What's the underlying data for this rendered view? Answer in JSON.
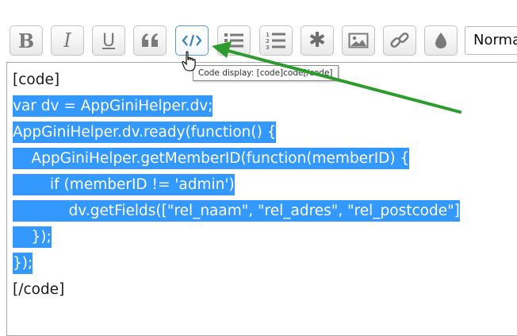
{
  "toolbar": {
    "buttons": [
      {
        "name": "bold-button",
        "icon": "bold-icon",
        "glyph": "B"
      },
      {
        "name": "italic-button",
        "icon": "italic-icon",
        "glyph": "I"
      },
      {
        "name": "underline-button",
        "icon": "underline-icon",
        "glyph": "U"
      },
      {
        "name": "quote-button",
        "icon": "quote-icon",
        "glyph": "❝"
      },
      {
        "name": "code-button",
        "icon": "code-icon",
        "glyph": "</>"
      },
      {
        "name": "bullet-list-button",
        "icon": "bullet-list-icon"
      },
      {
        "name": "numbered-list-button",
        "icon": "numbered-list-icon"
      },
      {
        "name": "asterisk-button",
        "icon": "asterisk-icon",
        "glyph": "✱"
      },
      {
        "name": "image-button",
        "icon": "image-icon"
      },
      {
        "name": "link-button",
        "icon": "link-icon"
      },
      {
        "name": "color-button",
        "icon": "droplet-icon"
      }
    ],
    "format_select": "Normal",
    "active_color": "#5b9bd5"
  },
  "tooltip": "Code display: [code]code[/code]",
  "editor": {
    "lines": [
      "[code]",
      "var dv = AppGiniHelper.dv;",
      "AppGiniHelper.dv.ready(function() {",
      "    AppGiniHelper.getMemberID(function(memberID) {",
      "        if (memberID != 'admin')",
      "            dv.getFields([\"rel_naam\", \"rel_adres\", \"rel_postcode\"]",
      "    });",
      "});",
      "[/code]"
    ],
    "selection_color": "#3399ff"
  },
  "annotation": {
    "arrow_color": "#2e9b2e"
  }
}
